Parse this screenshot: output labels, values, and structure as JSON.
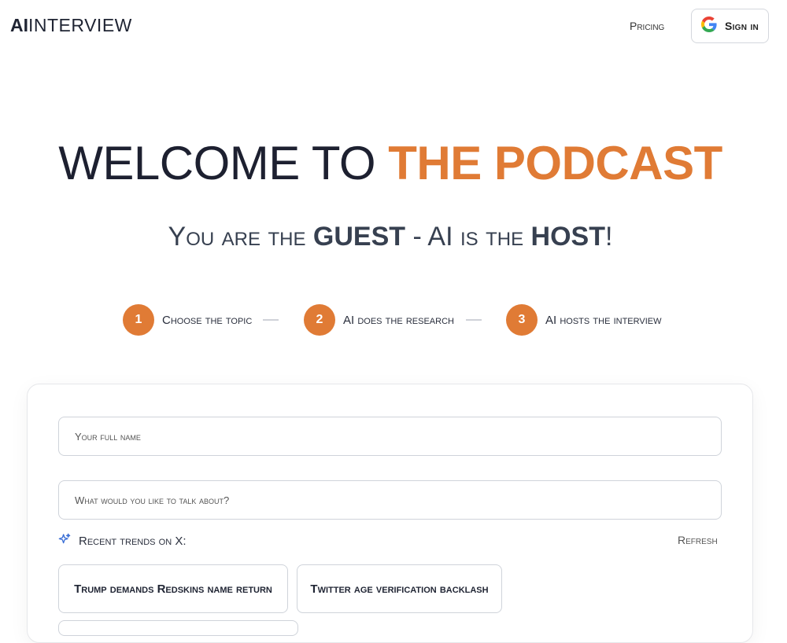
{
  "header": {
    "logo_bold": "AI",
    "logo_rest": "INTERVIEW",
    "pricing_label": "Pricing",
    "signin_label": "Sign in",
    "signin_icon": "google-icon"
  },
  "hero": {
    "title_plain": "WELCOME TO ",
    "title_accent": "THE PODCAST",
    "subtitle_a": "You are the ",
    "subtitle_b": "GUEST",
    "subtitle_c": " - AI is the ",
    "subtitle_d": "HOST",
    "subtitle_e": "!"
  },
  "steps": [
    {
      "number": "1",
      "label": "Choose the topic"
    },
    {
      "number": "2",
      "label": "AI does the research"
    },
    {
      "number": "3",
      "label": "AI hosts the interview"
    }
  ],
  "form": {
    "name_placeholder": "Your full name",
    "topic_placeholder": "What would you like to talk about?"
  },
  "trends": {
    "header_label": "Recent trends on X:",
    "header_icon": "sparkles-icon",
    "refresh_label": "Refresh",
    "items": [
      "Trump demands Redskins name return",
      "Twitter age verification backlash"
    ]
  },
  "colors": {
    "accent": "#e07b35",
    "text": "#1f2433",
    "border": "#cfd3da"
  }
}
